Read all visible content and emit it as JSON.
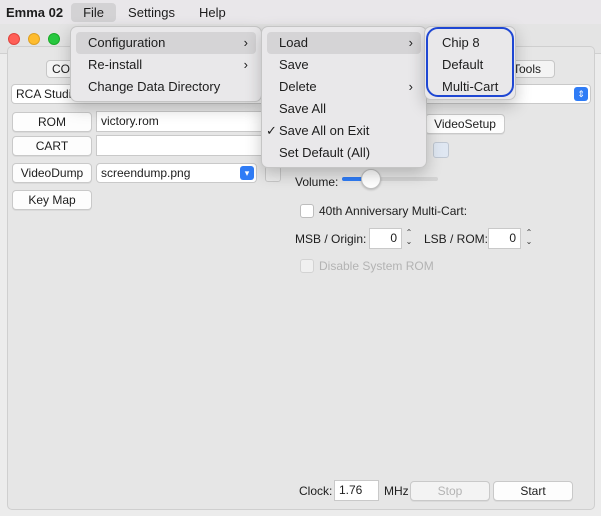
{
  "menubar": {
    "app": "Emma 02",
    "items": [
      "File",
      "Settings",
      "Help"
    ]
  },
  "tabs": {
    "left": "CO",
    "right": "Tools"
  },
  "computer_select": {
    "value": "RCA Studio"
  },
  "left_panel": {
    "rom_button": "ROM",
    "rom_value": "victory.rom",
    "cart_button": "CART",
    "cart_value": "",
    "videodump_button": "VideoDump",
    "videodump_value": "screendump.png",
    "keymap_button": "Key Map"
  },
  "right_panel": {
    "videosetup_button": "VideoSetup",
    "volume_label": "Volume:",
    "volume_level": 0.3,
    "anniversary_label": "40th Anniversary Multi-Cart:",
    "msb_label": "MSB / Origin:",
    "msb_value": "0",
    "lsb_label": "LSB / ROM:",
    "lsb_value": "0",
    "disable_rom_label": "Disable System ROM"
  },
  "footer": {
    "clock_label": "Clock:",
    "clock_value": "1.76",
    "mhz_label": "MHz",
    "stop_button": "Stop",
    "start_button": "Start"
  },
  "file_menu": {
    "items": [
      "Configuration",
      "Re-install",
      "Change Data Directory"
    ]
  },
  "config_menu": {
    "items": [
      "Load",
      "Save",
      "Delete",
      "Save All",
      "Save All on Exit",
      "Set Default (All)"
    ]
  },
  "load_menu": {
    "items": [
      "Chip 8",
      "Default",
      "Multi-Cart"
    ]
  },
  "colors": {
    "accent": "#2f7cf6",
    "highlight_ring": "#1f47d3"
  }
}
